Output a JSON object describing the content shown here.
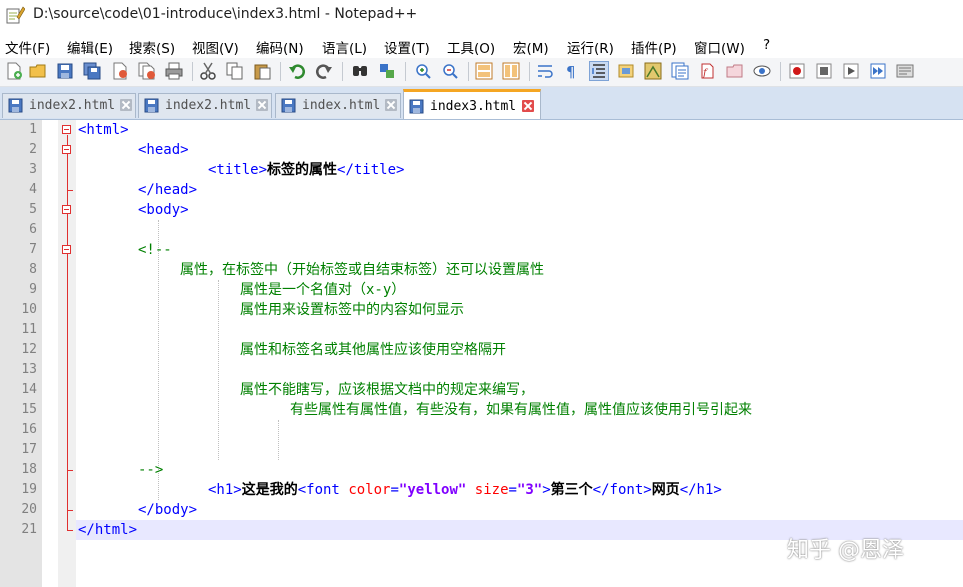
{
  "window": {
    "title": "D:\\source\\code\\01-introduce\\index3.html - Notepad++"
  },
  "menu": [
    "文件(F)",
    "编辑(E)",
    "搜索(S)",
    "视图(V)",
    "编码(N)",
    "语言(L)",
    "设置(T)",
    "工具(O)",
    "宏(M)",
    "运行(R)",
    "插件(P)",
    "窗口(W)",
    "?"
  ],
  "toolbar_icons": [
    "new-file-icon",
    "open-file-icon",
    "save-icon",
    "save-all-icon",
    "close-icon",
    "close-all-icon",
    "print-icon",
    "cut-icon",
    "copy-icon",
    "paste-icon",
    "undo-icon",
    "redo-icon",
    "find-icon",
    "replace-icon",
    "zoom-in-icon",
    "zoom-out-icon",
    "sync-vertical-icon",
    "sync-horizontal-icon",
    "word-wrap-icon",
    "show-all-chars-icon",
    "indent-guide-icon",
    "user-lang-icon",
    "doc-map-icon",
    "function-list-icon",
    "folder-workspace-icon",
    "monitoring-icon",
    "record-macro-icon",
    "stop-record-icon",
    "play-macro-icon",
    "run-macro-multiple-icon",
    "save-macro-icon"
  ],
  "tabs": [
    {
      "label": "index2.html",
      "active": false
    },
    {
      "label": "index2.html",
      "active": false
    },
    {
      "label": "index.html",
      "active": false
    },
    {
      "label": "index3.html",
      "active": true
    }
  ],
  "line_numbers": [
    "1",
    "2",
    "3",
    "4",
    "5",
    "6",
    "7",
    "8",
    "9",
    "10",
    "11",
    "12",
    "13",
    "14",
    "15",
    "16",
    "17",
    "18",
    "19",
    "20",
    "21"
  ],
  "code": {
    "l1": {
      "tag": "<html>"
    },
    "l2": {
      "tag": "<head>"
    },
    "l3": {
      "open": "<title>",
      "text": "标签的属性",
      "close": "</title>"
    },
    "l4": {
      "tag": "</head>"
    },
    "l5": {
      "tag": "<body>"
    },
    "l7": {
      "comment": "<!--"
    },
    "l8": {
      "comment": "属性，在标签中（开始标签或自结束标签）还可以设置属性"
    },
    "l9": {
      "comment": "属性是一个名值对（x-y）"
    },
    "l10": {
      "comment": "属性用来设置标签中的内容如何显示"
    },
    "l12": {
      "comment": "属性和标签名或其他属性应该使用空格隔开"
    },
    "l14": {
      "comment": "属性不能瞎写，应该根据文档中的规定来编写，"
    },
    "l15": {
      "comment": "有些属性有属性值，有些没有，如果有属性值，属性值应该使用引号引起来"
    },
    "l18": {
      "comment": "-->"
    },
    "l19": {
      "h1_open": "<h1>",
      "text1": "这是我的",
      "font_open": "<font",
      "attr1": "color",
      "eq1": "=",
      "val1": "\"yellow\"",
      "attr2": "size",
      "eq2": "=",
      "val2": "\"3\"",
      "gt": ">",
      "text2": "第三个",
      "font_close": "</font>",
      "text3": "网页",
      "h1_close": "</h1>"
    },
    "l20": {
      "tag": "</body>"
    },
    "l21": {
      "tag": "</html>"
    }
  },
  "watermark": "知乎 @恩泽",
  "colors": {
    "tag": "#0000ff",
    "comment": "#008000",
    "attr": "#ff0000",
    "value": "#8000ff",
    "fold": "#e03030",
    "active_tab_accent": "#f5a623"
  }
}
